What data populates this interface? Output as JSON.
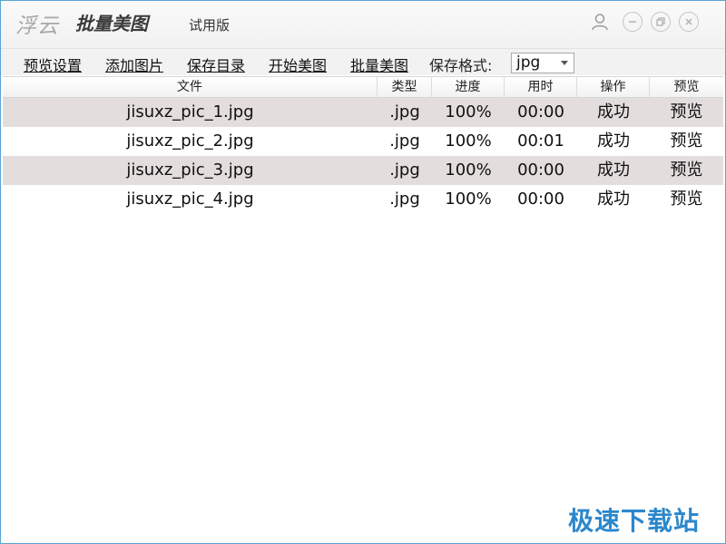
{
  "title_bar": {
    "brand": "浮云",
    "product": "批量美图",
    "edition": "试用版",
    "buttons": [
      "user-icon",
      "minimize-icon",
      "restore-icon",
      "close-icon"
    ]
  },
  "toolbar": {
    "preview_settings": "预览设置",
    "add_images": "添加图片",
    "save_dir": "保存目录",
    "start_beautify": "开始美图",
    "batch_beautify": "批量美图",
    "format_label": "保存格式:",
    "format_value": "jpg"
  },
  "table": {
    "headers": {
      "file": "文件",
      "type": "类型",
      "progress": "进度",
      "time": "用时",
      "action": "操作",
      "preview": "预览"
    },
    "rows": [
      {
        "file": "jisuxz_pic_1.jpg",
        "type": ".jpg",
        "progress": "100%",
        "time": "00:00",
        "action": "成功",
        "preview": "预览"
      },
      {
        "file": "jisuxz_pic_2.jpg",
        "type": ".jpg",
        "progress": "100%",
        "time": "00:01",
        "action": "成功",
        "preview": "预览"
      },
      {
        "file": "jisuxz_pic_3.jpg",
        "type": ".jpg",
        "progress": "100%",
        "time": "00:00",
        "action": "成功",
        "preview": "预览"
      },
      {
        "file": "jisuxz_pic_4.jpg",
        "type": ".jpg",
        "progress": "100%",
        "time": "00:00",
        "action": "成功",
        "preview": "预览"
      }
    ]
  },
  "watermark": "极速下载站",
  "colors": {
    "accent_border": "#5aa3d6",
    "row_shade": "#e3dddd",
    "watermark": "#2c87cc"
  }
}
